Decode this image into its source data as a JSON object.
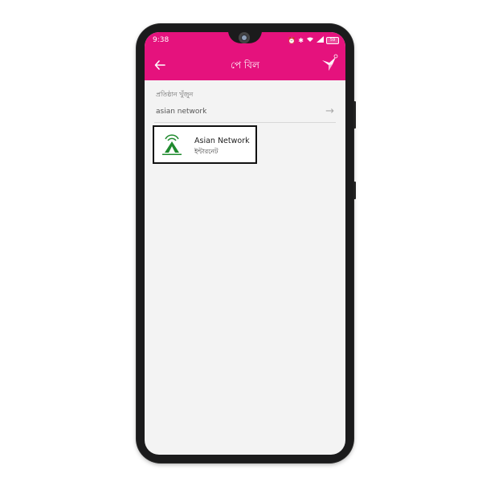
{
  "status_bar": {
    "time": "9:38",
    "icons": [
      "alarm-icon",
      "location-icon",
      "bluetooth-icon",
      "wifi-icon",
      "signal-icon"
    ],
    "battery_level": "59"
  },
  "app_bar": {
    "title": "পে বিল"
  },
  "search": {
    "label": "প্রতিষ্ঠান খুঁজুন",
    "value": "asian network"
  },
  "results": [
    {
      "name": "Asian Network",
      "type": "ইন্টারনেট",
      "logo_text": "ASIAN NETWORK"
    }
  ],
  "colors": {
    "accent": "#e5127d",
    "background": "#f3f3f3",
    "logo_green": "#1f8a2e"
  }
}
